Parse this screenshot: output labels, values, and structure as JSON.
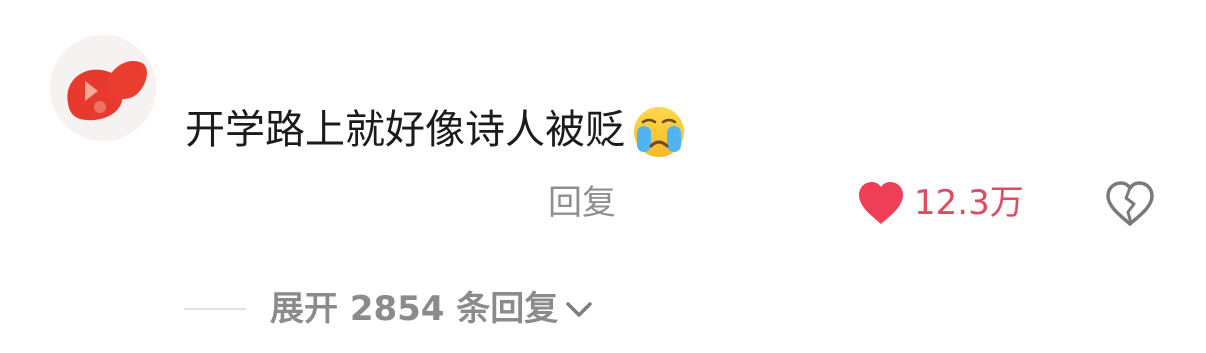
{
  "comment": {
    "text": "开学路上就好像诗人被贬",
    "emoji": "crying-face"
  },
  "actions": {
    "reply_label": "回复",
    "like_count": "12.3万",
    "heart_color": "#ef3f57",
    "like_text_color": "#e24a5f"
  },
  "replies": {
    "expand_label": "展开 2854 条回复"
  },
  "icons": [
    "avatar-image",
    "crying-face-emoji",
    "heart-icon",
    "broken-heart-icon",
    "chevron-down-icon"
  ]
}
